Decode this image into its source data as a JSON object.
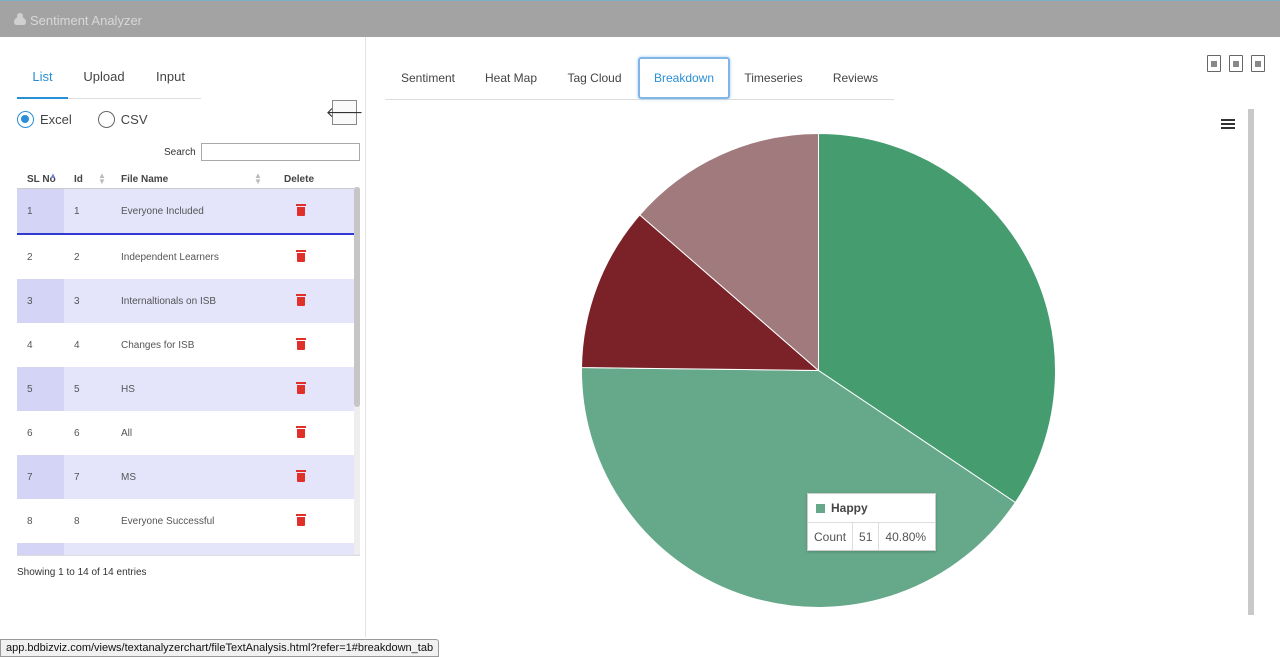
{
  "app": {
    "title": "Sentiment Analyzer"
  },
  "left": {
    "tabs": [
      {
        "label": "List",
        "active": true
      },
      {
        "label": "Upload",
        "active": false
      },
      {
        "label": "Input",
        "active": false
      }
    ],
    "radios": [
      {
        "label": "Excel",
        "checked": true
      },
      {
        "label": "CSV",
        "checked": false
      }
    ],
    "back_icon": "arrow-left-icon",
    "search": {
      "label": "Search",
      "value": ""
    },
    "table": {
      "headers": [
        "SL No",
        "Id",
        "File Name",
        "Delete"
      ],
      "rows": [
        {
          "sl": "1",
          "id": "1",
          "name": "Everyone Included"
        },
        {
          "sl": "2",
          "id": "2",
          "name": "Independent Learners"
        },
        {
          "sl": "3",
          "id": "3",
          "name": "Internaltionals on ISB"
        },
        {
          "sl": "4",
          "id": "4",
          "name": "Changes for ISB"
        },
        {
          "sl": "5",
          "id": "5",
          "name": "HS"
        },
        {
          "sl": "6",
          "id": "6",
          "name": "All"
        },
        {
          "sl": "7",
          "id": "7",
          "name": "MS"
        },
        {
          "sl": "8",
          "id": "8",
          "name": "Everyone Successful"
        }
      ]
    },
    "showing": "Showing 1 to 14 of 14 entries"
  },
  "right": {
    "tabs": [
      {
        "label": "Sentiment",
        "active": false
      },
      {
        "label": "Heat Map",
        "active": false
      },
      {
        "label": "Tag Cloud",
        "active": false
      },
      {
        "label": "Breakdown",
        "active": true
      },
      {
        "label": "Timeseries",
        "active": false
      },
      {
        "label": "Reviews",
        "active": false
      }
    ],
    "export_icons": [
      "export-image-icon",
      "export-excel-icon",
      "export-csv-icon"
    ],
    "menu_icon": "list-menu-icon"
  },
  "colors": {
    "accent": "#2a8fd6",
    "row_highlight": "#e4e4fb",
    "delete": "#e0302a"
  },
  "chart_data": {
    "type": "pie",
    "slices": [
      {
        "value": 34.4,
        "color": "#449c6f"
      },
      {
        "name": "Happy",
        "count": 51,
        "value": 40.8,
        "color": "#66a98a"
      },
      {
        "value": 11.2,
        "color": "#7a2227"
      },
      {
        "value": 13.6,
        "color": "#a07a7c"
      }
    ],
    "tooltip": {
      "series": "Happy",
      "label": "Count",
      "count": "51",
      "percent": "40.80%"
    }
  },
  "status_url": "app.bdbizviz.com/views/textanalyzerchart/fileTextAnalysis.html?refer=1#breakdown_tab"
}
